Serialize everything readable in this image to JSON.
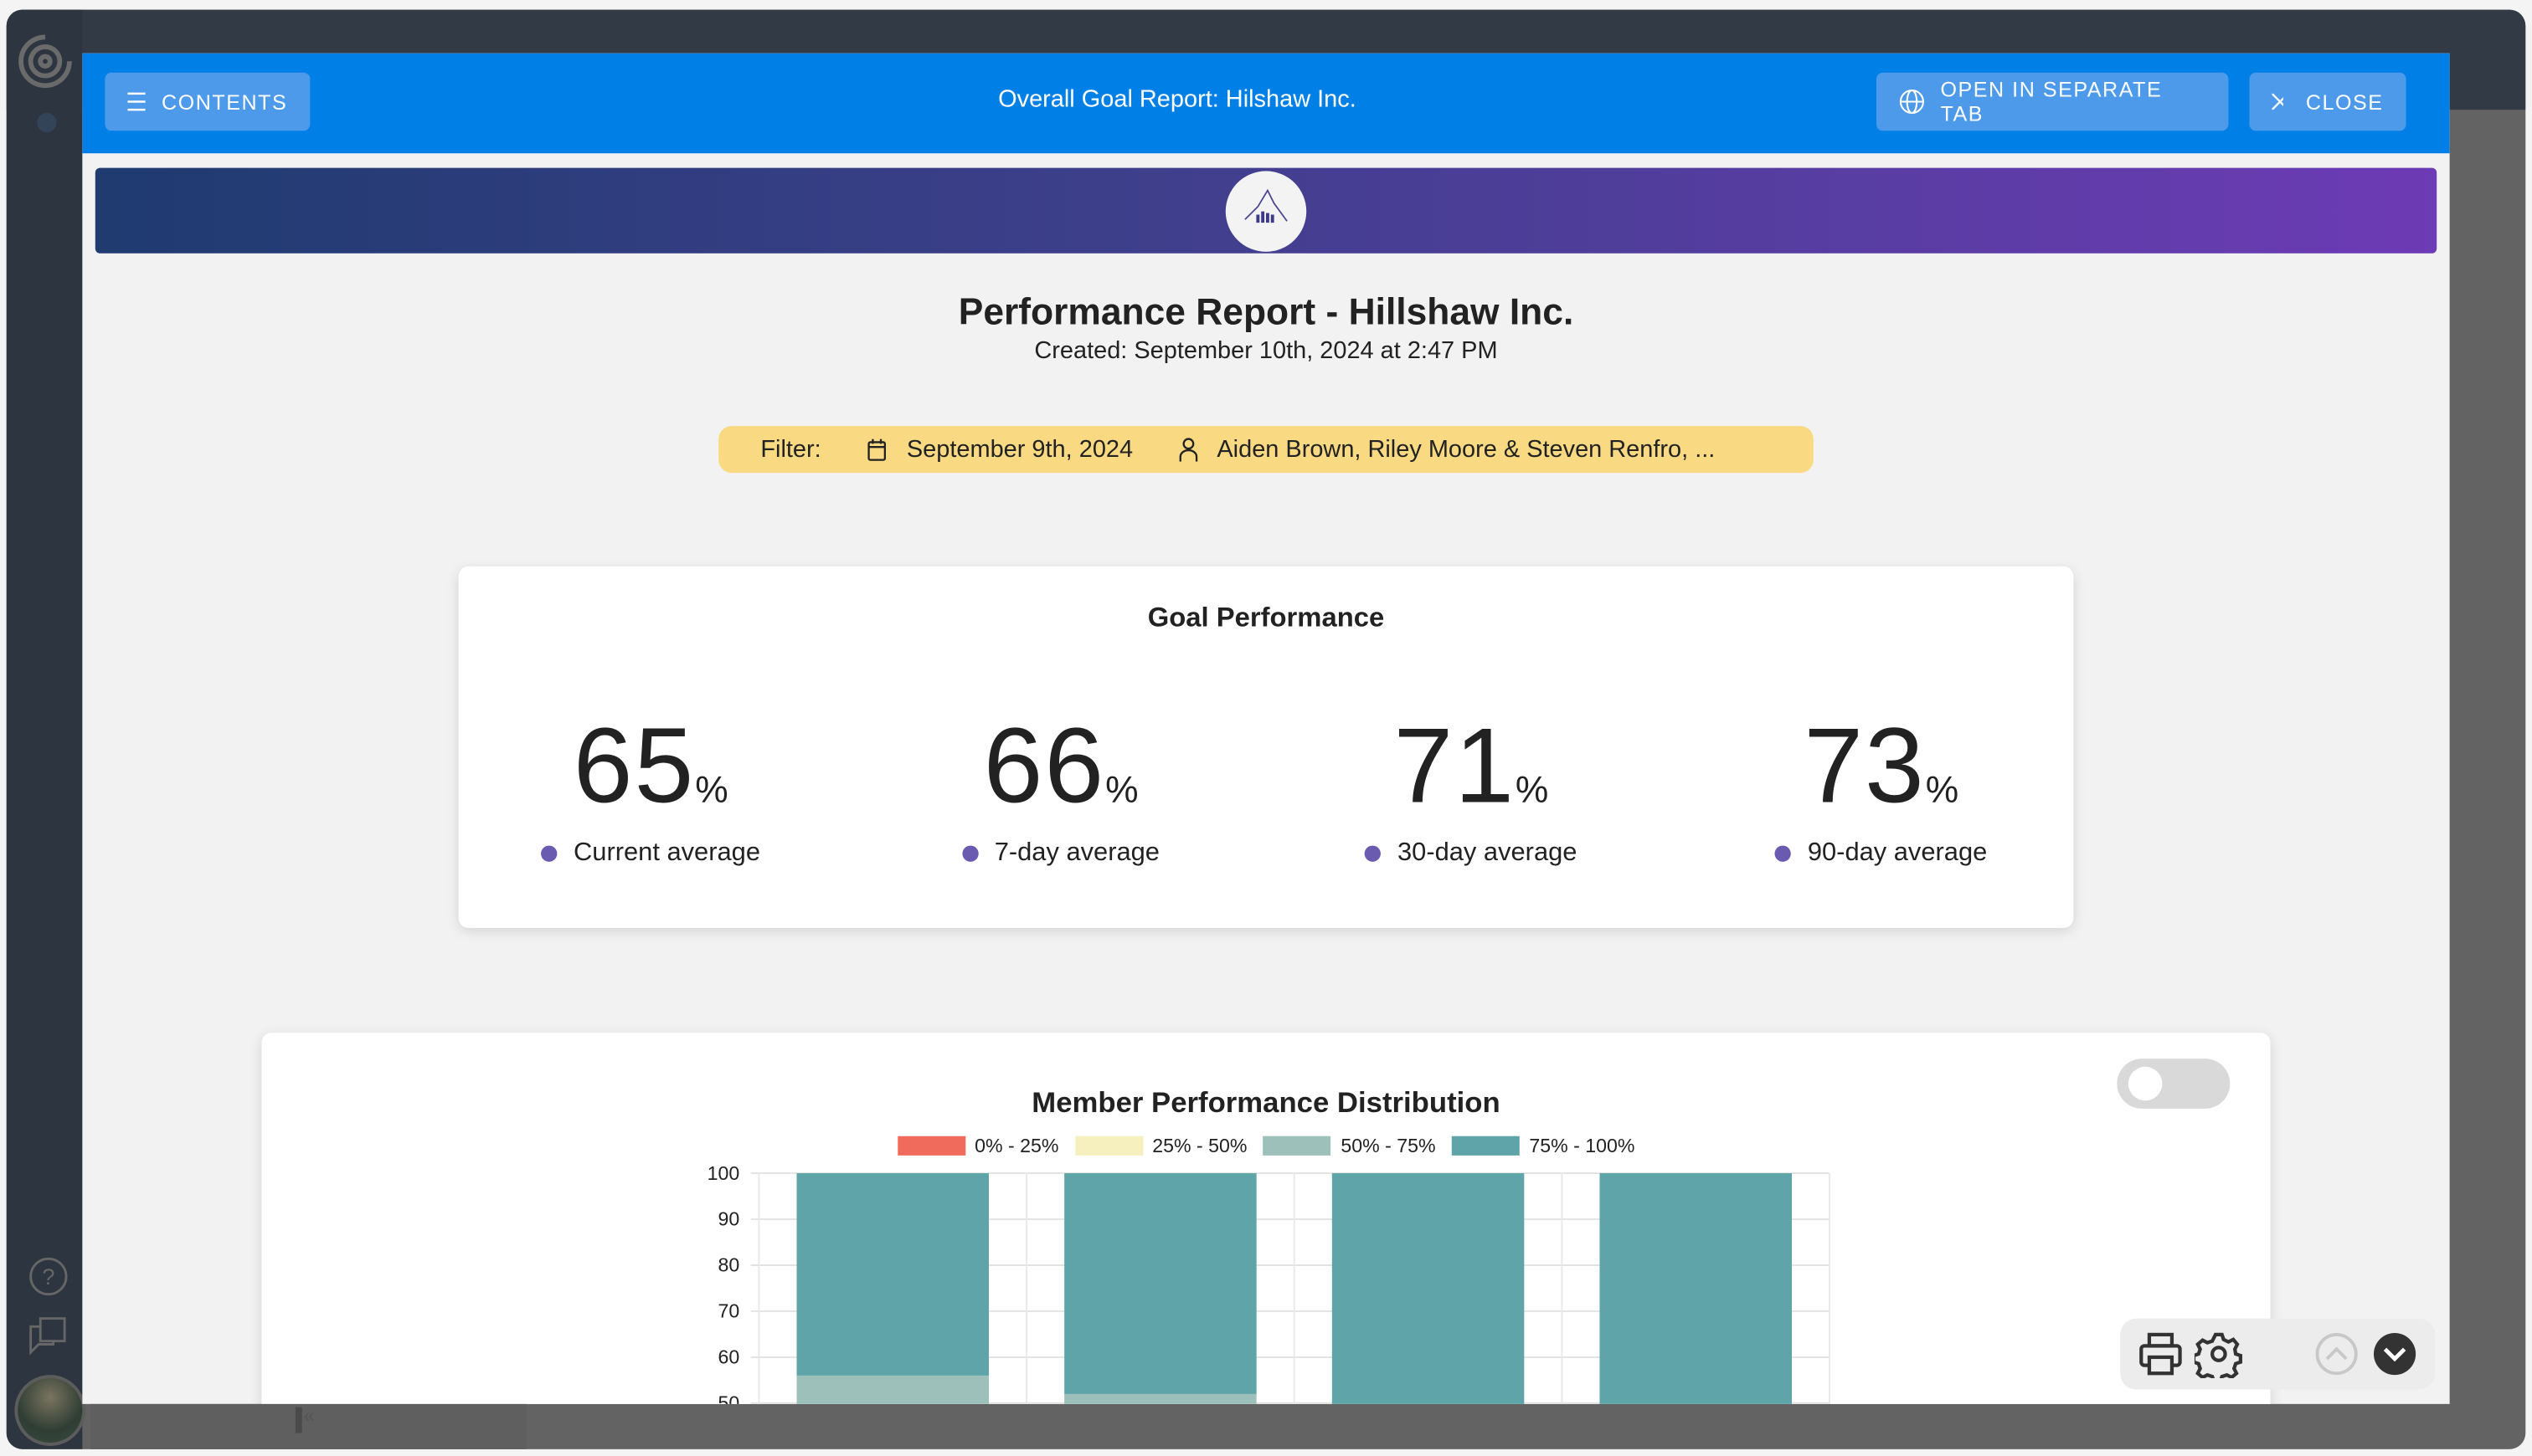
{
  "modal": {
    "contents_label": "CONTENTS",
    "title": "Overall Goal Report: Hilshaw Inc.",
    "open_tab_label": "OPEN IN SEPARATE TAB",
    "close_label": "CLOSE"
  },
  "report": {
    "title": "Performance Report - Hillshaw Inc.",
    "created": "Created: September 10th, 2024 at 2:47 PM",
    "filter": {
      "label": "Filter:",
      "date": "September 9th, 2024",
      "members": "Aiden Brown, Riley Moore & Steven Renfro, ..."
    }
  },
  "goal_performance": {
    "title": "Goal Performance",
    "percent_sign": "%",
    "stats": [
      {
        "value": "65",
        "label": "Current average"
      },
      {
        "value": "66",
        "label": "7-day average"
      },
      {
        "value": "71",
        "label": "30-day average"
      },
      {
        "value": "73",
        "label": "90-day average"
      }
    ],
    "dot_color": "#6a5bb0"
  },
  "chart_data": {
    "type": "bar",
    "stacked": true,
    "title": "Member Performance Distribution",
    "legend_position": "top",
    "grid": true,
    "ylim": [
      50,
      100
    ],
    "yticks": [
      "100",
      "90",
      "80",
      "70",
      "60",
      "50"
    ],
    "categories": [
      "",
      "",
      "",
      ""
    ],
    "series": [
      {
        "name": "0% - 25%",
        "color": "#f06b5b",
        "values": [
          0,
          0,
          0,
          0
        ]
      },
      {
        "name": "25% - 50%",
        "color": "#f5f0bd",
        "values": [
          0,
          0,
          0,
          0
        ]
      },
      {
        "name": "50% - 75%",
        "color": "#9dc0bb",
        "values": [
          56,
          52,
          0,
          0
        ]
      },
      {
        "name": "75% - 100%",
        "color": "#5ea4a8",
        "values": [
          44,
          48,
          100,
          100
        ]
      }
    ]
  },
  "colors": {
    "header": "#0080e6",
    "banner_start": "#1f3b70",
    "banner_end": "#6d3bb5",
    "filter_bg": "#f9da82"
  }
}
